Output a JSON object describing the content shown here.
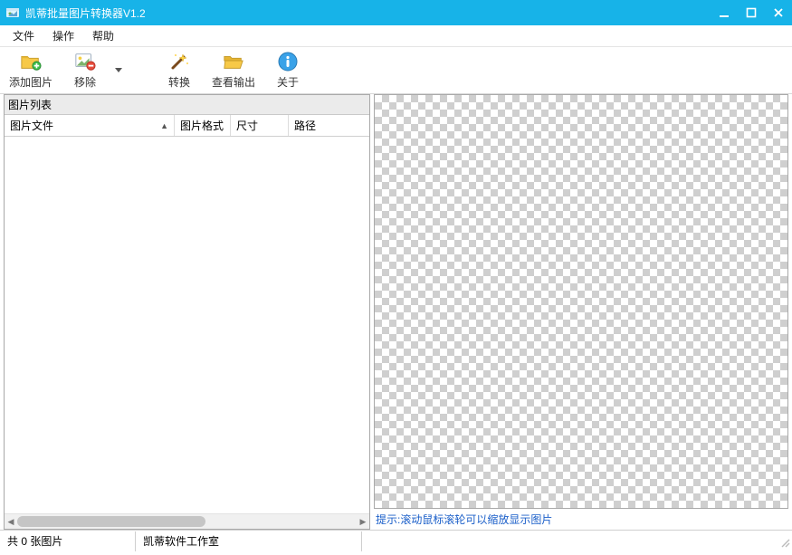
{
  "app": {
    "title": "凯蒂批量图片转换器V1.2"
  },
  "menu": {
    "file": "文件",
    "operate": "操作",
    "help": "帮助"
  },
  "toolbar": {
    "add": "添加图片",
    "remove": "移除",
    "convert": "转换",
    "view_output": "查看输出",
    "about": "关于"
  },
  "left_panel": {
    "title": "图片列表",
    "columns": {
      "file": "图片文件",
      "format": "图片格式",
      "size": "尺寸",
      "path": "路径"
    }
  },
  "right_panel": {
    "hint": "提示:滚动鼠标滚轮可以缩放显示图片"
  },
  "statusbar": {
    "count": "共 0 张图片",
    "studio": "凯蒂软件工作室"
  }
}
